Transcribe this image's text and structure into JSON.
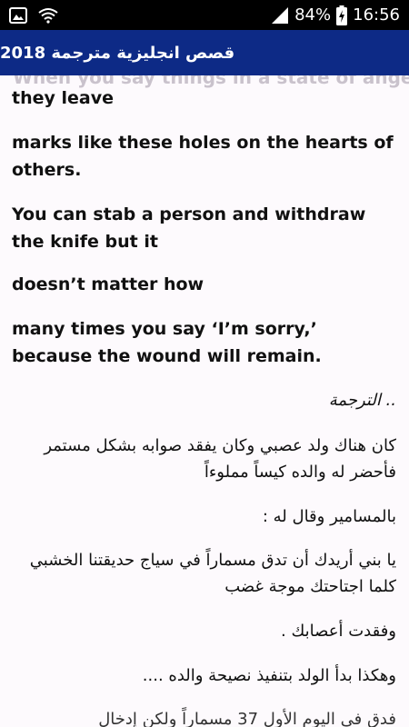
{
  "status_bar": {
    "battery_percent": "84%",
    "time": "16:56",
    "icons": [
      "image-icon",
      "wifi-icon",
      "signal-icon",
      "battery-charging-icon"
    ]
  },
  "app_bar": {
    "title": "قصص انجليزية مترجمة 2018",
    "background_color": "#0d2a86"
  },
  "content": {
    "top_faded_line": "When you say things in a state of anger,",
    "paragraphs_en": [
      "they leave",
      "marks like these holes on the hearts of others.",
      "You can stab a person and withdraw the knife but it",
      "doesn’t matter how",
      "many times you say ‘I’m sorry,’ because the wound will remain."
    ],
    "paragraphs_ar": [
      ".. الترجمة",
      "كان هناك ولد عصبي وكان يفقد صوابه بشكل مستمر فأحضر له والده كيساً مملوءاً",
      "بالمسامير وقال له :",
      "يا بني أريدك أن تدق مسماراً في سياج حديقتنا الخشبي كلما اجتاحتك موجة غضب",
      "وفقدت أعصابك .",
      "وهكذا بدأ الولد بتنفيذ نصيحة والده ....",
      "فدق في اليوم الأول 37 مسماراً ولكن إدخال"
    ]
  }
}
